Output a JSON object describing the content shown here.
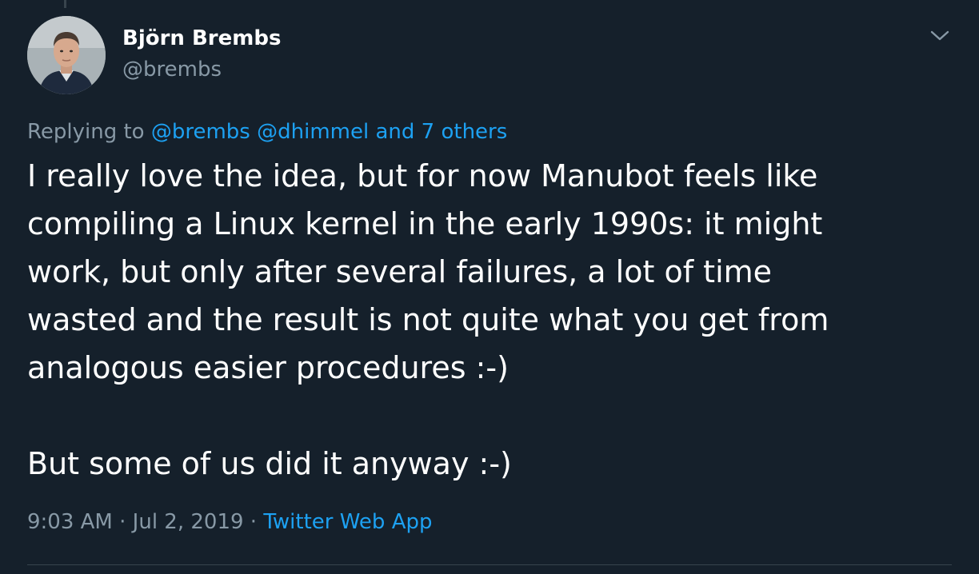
{
  "author": {
    "name": "Björn Brembs",
    "handle": "@brembs"
  },
  "reply": {
    "prefix": "Replying to ",
    "mention_1": "@brembs",
    "mention_2": "@dhimmel",
    "others": "and 7 others"
  },
  "tweet": {
    "paragraph_1": "I really love the idea, but for now Manubot feels like\ncompiling a Linux kernel in the early 1990s: it might\nwork, but only after several failures, a lot of time\nwasted and the result is not quite what you get from\nanalogous easier procedures :-)",
    "paragraph_2": "But some of us did it anyway :-)"
  },
  "meta": {
    "time": "9:03 AM",
    "separator": " · ",
    "date": "Jul 2, 2019",
    "source": "Twitter Web App"
  },
  "icons": {
    "menu": "chevron-down-icon",
    "avatar": "user-avatar"
  },
  "colors": {
    "background": "#15202b",
    "primary_text": "#ffffff",
    "secondary_text": "#8899a6",
    "link": "#1da1f2",
    "divider": "#38444d"
  }
}
